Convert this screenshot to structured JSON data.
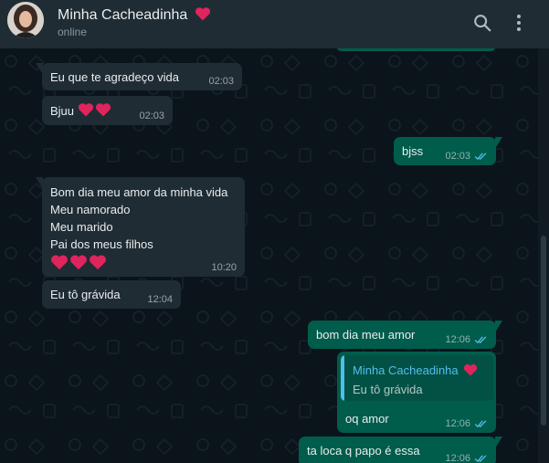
{
  "contact": {
    "name": "Minha Cacheadinha",
    "status": "online"
  },
  "header_icons": [
    "search-icon",
    "menu-dots-icon"
  ],
  "colors": {
    "incoming_bubble": "#202c33",
    "outgoing_bubble": "#005c4b",
    "read_ticks": "#53bdeb",
    "heart": "#e0245e"
  },
  "messages": [
    {
      "dir": "in",
      "lines": [
        "Eu que te agradeço vida"
      ],
      "time": "02:03"
    },
    {
      "dir": "in",
      "lines": [
        "Bjuu"
      ],
      "hearts": 2,
      "time": "02:03"
    },
    {
      "dir": "out",
      "lines": [
        "bjss"
      ],
      "time": "02:03",
      "read": true
    },
    {
      "dir": "in",
      "lines": [
        "Bom dia meu amor da minha vida",
        "Meu namorado",
        "Meu marido",
        "Pai dos meus filhos"
      ],
      "hearts": 3,
      "time": "10:20"
    },
    {
      "dir": "in",
      "lines": [
        "Eu tô grávida"
      ],
      "time": "12:04"
    },
    {
      "dir": "out",
      "lines": [
        "bom dia meu amor"
      ],
      "time": "12:06",
      "read": true
    },
    {
      "dir": "out",
      "reply": {
        "author": "Minha Cacheadinha",
        "text": "Eu tô grávida"
      },
      "lines": [
        "oq amor"
      ],
      "time": "12:06",
      "read": true
    },
    {
      "dir": "out",
      "lines": [
        "ta loca q papo é essa"
      ],
      "time": "12:06",
      "read": true
    }
  ]
}
